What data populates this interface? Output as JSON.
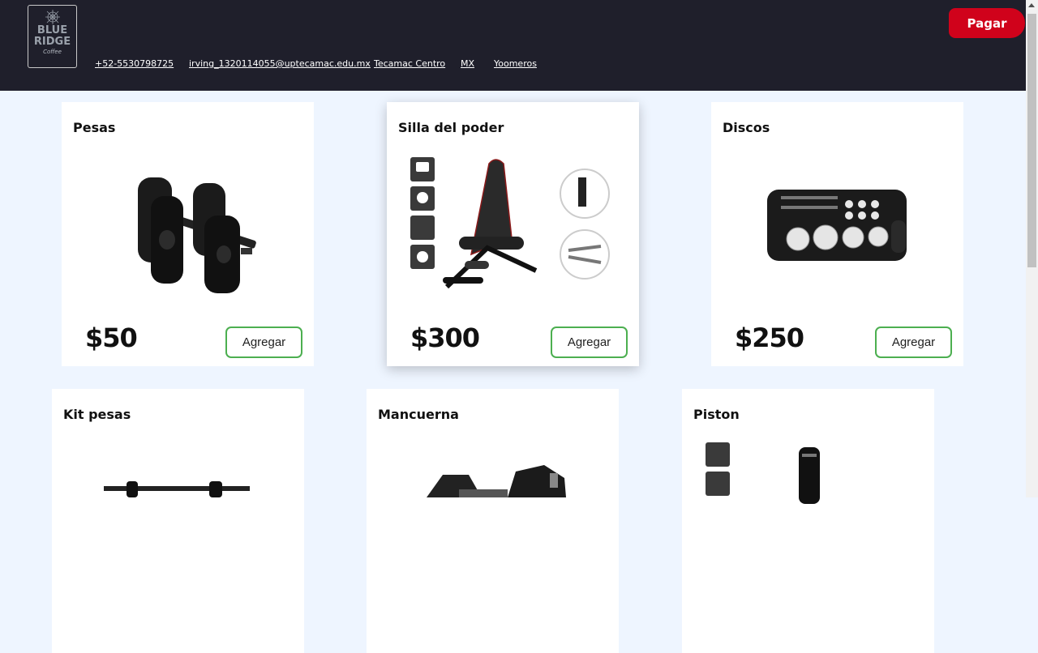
{
  "header": {
    "logo": {
      "line1": "BLUE",
      "line2": "RIDGE",
      "line3": "Coffee"
    },
    "nav": [
      {
        "label": "+52-5530798725"
      },
      {
        "label": "irving_1320114055@uptecamac.edu.mx"
      },
      {
        "label": "Tecamac Centro"
      },
      {
        "label": "MX"
      },
      {
        "label": "Yoomeros"
      }
    ],
    "pay_label": "Pagar"
  },
  "products": [
    {
      "title": "Pesas",
      "price": "$50",
      "button": "Agregar",
      "image": "dumbbells"
    },
    {
      "title": "Silla del poder",
      "price": "$300",
      "button": "Agregar",
      "image": "bench"
    },
    {
      "title": "Discos",
      "price": "$250",
      "button": "Agregar",
      "image": "plate-case"
    },
    {
      "title": "Kit pesas",
      "image": "dumbbell-kit"
    },
    {
      "title": "Mancuerna",
      "image": "hex-dumbbell"
    },
    {
      "title": "Piston",
      "image": "bar-piston"
    }
  ],
  "colors": {
    "header": "#1f1f2b",
    "pay": "#d0021b",
    "add_border": "#4caf50",
    "background": "#eef5ff"
  }
}
